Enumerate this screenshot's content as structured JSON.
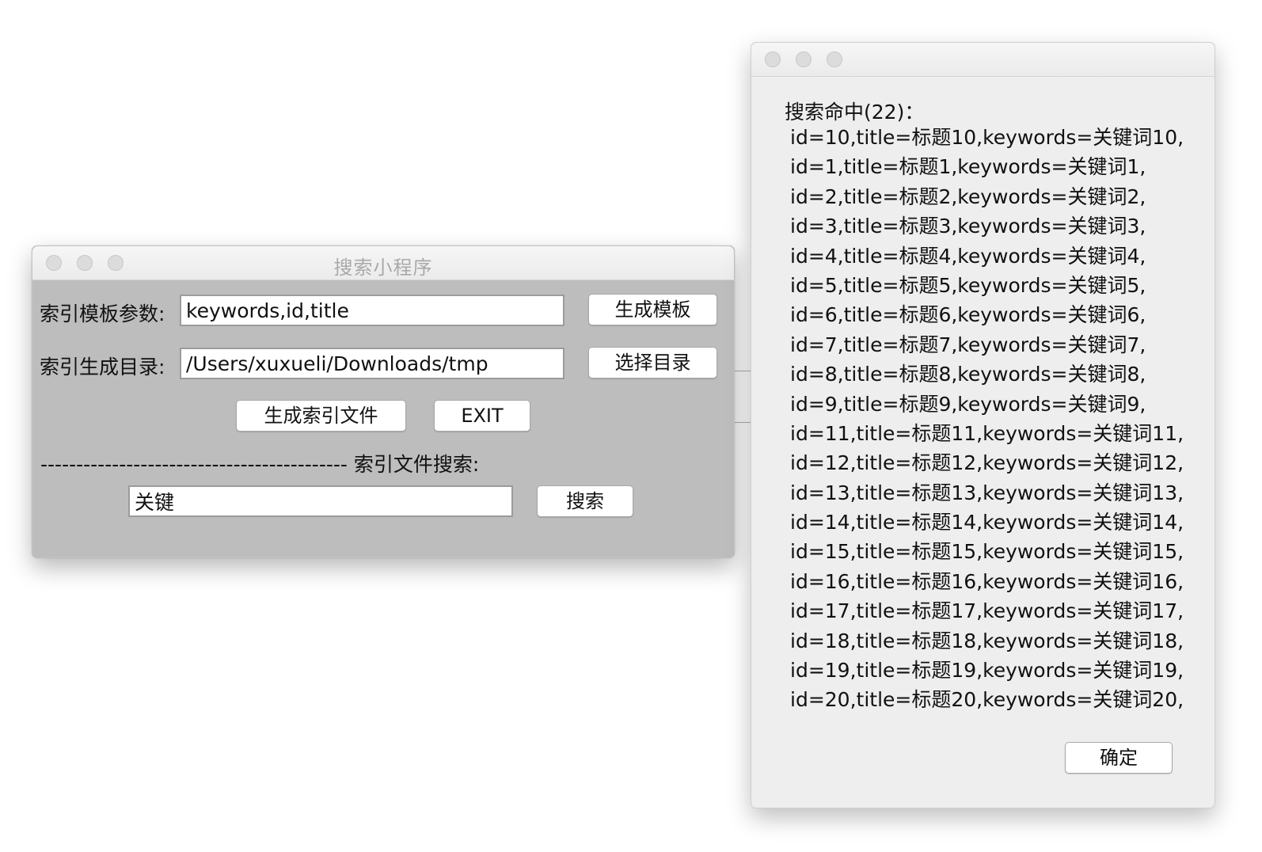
{
  "main_window": {
    "title": "搜索小程序",
    "template_label": "索引模板参数:",
    "template_value": "keywords,id,title",
    "generate_template_button": "生成模板",
    "dir_label": "索引生成目录:",
    "dir_value": "/Users/xuxueli/Downloads/tmp",
    "choose_dir_button": "选择目录",
    "generate_index_button": "生成索引文件",
    "exit_button": "EXIT",
    "separator_text": "------------------------------------------- 索引文件搜索:",
    "search_value": "关键",
    "search_button": "搜索"
  },
  "result_dialog": {
    "header": "搜索命中(22)：",
    "results": [
      "id=10,title=标题10,keywords=关键词10,",
      "id=1,title=标题1,keywords=关键词1,",
      "id=2,title=标题2,keywords=关键词2,",
      "id=3,title=标题3,keywords=关键词3,",
      "id=4,title=标题4,keywords=关键词4,",
      "id=5,title=标题5,keywords=关键词5,",
      "id=6,title=标题6,keywords=关键词6,",
      "id=7,title=标题7,keywords=关键词7,",
      "id=8,title=标题8,keywords=关键词8,",
      "id=9,title=标题9,keywords=关键词9,",
      "id=11,title=标题11,keywords=关键词11,",
      "id=12,title=标题12,keywords=关键词12,",
      "id=13,title=标题13,keywords=关键词13,",
      "id=14,title=标题14,keywords=关键词14,",
      "id=15,title=标题15,keywords=关键词15,",
      "id=16,title=标题16,keywords=关键词16,",
      "id=17,title=标题17,keywords=关键词17,",
      "id=18,title=标题18,keywords=关键词18,",
      "id=19,title=标题19,keywords=关键词19,",
      "id=20,title=标题20,keywords=关键词20,"
    ],
    "ok_button": "确定"
  },
  "colors": {
    "main_window_bg": "#bdbdbd",
    "dialog_bg": "#eeeeee",
    "traffic_light_inactive": "#dcdcdc"
  },
  "icons": {
    "close": "close-icon",
    "minimize": "minimize-icon",
    "zoom": "zoom-icon"
  }
}
